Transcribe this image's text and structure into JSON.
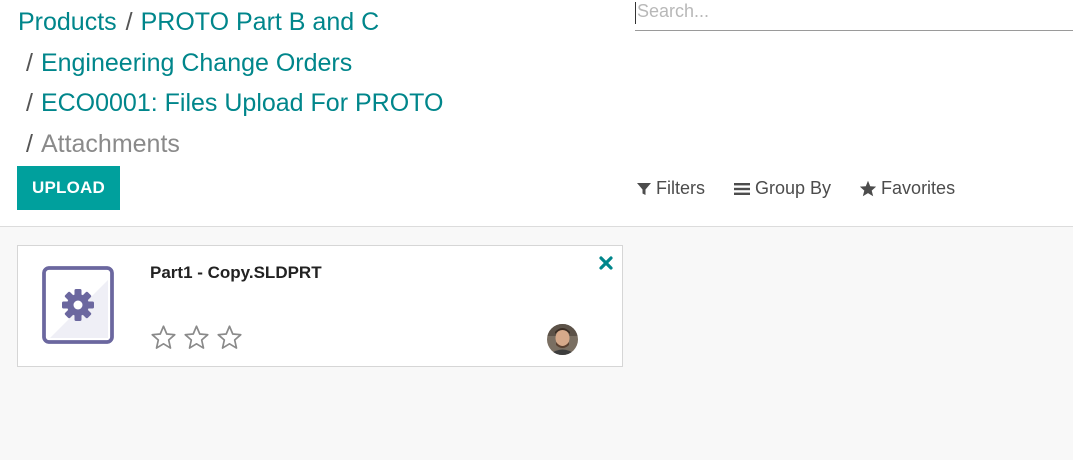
{
  "breadcrumb": {
    "items": [
      {
        "label": "Products"
      },
      {
        "label": "PROTO Part B and C"
      },
      {
        "label": "Engineering Change Orders"
      },
      {
        "label": "ECO0001: Files Upload For PROTO"
      },
      {
        "label": "Attachments"
      }
    ],
    "separator": "/"
  },
  "search": {
    "placeholder": "Search...",
    "value": ""
  },
  "toolbar": {
    "upload_label": "UPLOAD"
  },
  "search_options": {
    "filters_label": "Filters",
    "group_by_label": "Group By",
    "favorites_label": "Favorites"
  },
  "colors": {
    "accent": "#00a09d",
    "link": "#00868b",
    "icon_purple": "#6b679f"
  },
  "kanban": {
    "cards": [
      {
        "file_name": "Part1 - Copy.SLDPRT",
        "file_icon": "gear-icon",
        "rating": 0,
        "rating_max": 3,
        "remove_icon": "close-icon",
        "owner_avatar": "avatar"
      }
    ]
  }
}
